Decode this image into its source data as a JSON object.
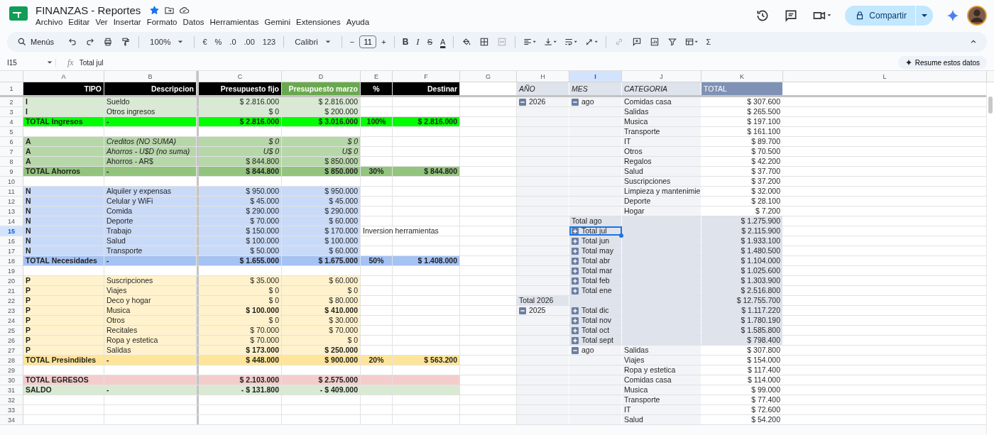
{
  "doc": {
    "title": "FINANZAS - Reportes",
    "starred": true
  },
  "menus": [
    "Archivo",
    "Editar",
    "Ver",
    "Insertar",
    "Formato",
    "Datos",
    "Herramientas",
    "Gemini",
    "Extensiones",
    "Ayuda"
  ],
  "share": {
    "label": "Compartir"
  },
  "toolbar": {
    "search": "Menús",
    "zoom": "100%",
    "number_formats": [
      "€",
      "%",
      ".0",
      ".00",
      "123"
    ],
    "font": "Calibri",
    "size_down": "−",
    "font_size": "11",
    "size_up": "+",
    "text_styles": [
      "B",
      "I",
      "S",
      "A"
    ],
    "sum": "Σ"
  },
  "formula_bar": {
    "cell": "I15",
    "fx": "fx",
    "content": "Total jul"
  },
  "summarize": {
    "label": "Resume estos datos"
  },
  "columns": [
    {
      "label": "A",
      "selected": false
    },
    {
      "label": "B",
      "selected": false
    },
    {
      "label": "C",
      "selected": false
    },
    {
      "label": "D",
      "selected": false
    },
    {
      "label": "E",
      "selected": false
    },
    {
      "label": "F",
      "selected": false
    },
    {
      "label": "G",
      "selected": false
    },
    {
      "label": "H",
      "selected": false
    },
    {
      "label": "I",
      "selected": true
    },
    {
      "label": "J",
      "selected": false
    },
    {
      "label": "K",
      "selected": false
    },
    {
      "label": "L",
      "selected": false
    }
  ],
  "rows": [
    {
      "num": "1",
      "selected": false,
      "kind": "header",
      "tipo": "TIPO",
      "descripcion": "Descripcion",
      "fijo": "Presupuesto fijo",
      "marzo": "Presupuesto marzo",
      "pct": "%",
      "destinar": "Destinar",
      "pivot": {
        "kind": "header",
        "year": "AÑO",
        "month": "MES",
        "category": "CATEGORIA",
        "total": "TOTAL"
      }
    },
    {
      "num": "2",
      "selected": false,
      "kind": "ingreso",
      "tipo": "I",
      "descripcion": "Sueldo",
      "fijo": "$ 2.816.000",
      "marzo": "$ 2.816.000",
      "pivot": {
        "kind": "detail",
        "year": "2026",
        "year_expanded": true,
        "month": "ago",
        "month_expanded": true,
        "category": "Comidas casa",
        "total": "$ 307.600"
      }
    },
    {
      "num": "3",
      "selected": false,
      "kind": "ingreso",
      "tipo": "I",
      "descripcion": "Otros ingresos",
      "fijo": "$ 0",
      "marzo": "$ 200.000",
      "pivot": {
        "kind": "detail",
        "category": "Salidas",
        "total": "$ 265.500"
      }
    },
    {
      "num": "4",
      "selected": false,
      "kind": "ingreso_total",
      "tipo": "TOTAL Ingresos",
      "descripcion": "-",
      "fijo": "$ 2.816.000",
      "marzo": "$ 3.016.000",
      "pct": "100%",
      "destinar": "$ 2.816.000",
      "pivot": {
        "kind": "detail",
        "category": "Musica",
        "total": "$ 197.100"
      }
    },
    {
      "num": "5",
      "selected": false,
      "kind": "blank",
      "pivot": {
        "kind": "detail",
        "category": "Transporte",
        "total": "$ 161.100"
      }
    },
    {
      "num": "6",
      "selected": false,
      "kind": "ahorro_nota",
      "tipo": "A",
      "descripcion": "Creditos (NO SUMA)",
      "fijo": "$ 0",
      "marzo": "$ 0",
      "pivot": {
        "kind": "detail",
        "category": "IT",
        "total": "$ 89.700"
      }
    },
    {
      "num": "7",
      "selected": false,
      "kind": "ahorro_nota",
      "tipo": "A",
      "descripcion": "Ahorros - U$D (no suma)",
      "fijo": "U$ 0",
      "marzo": "U$ 0",
      "pivot": {
        "kind": "detail",
        "category": "Otros",
        "total": "$ 70.500"
      }
    },
    {
      "num": "8",
      "selected": false,
      "kind": "ahorro",
      "tipo": "A",
      "descripcion": "Ahorros - AR$",
      "fijo": "$ 844.800",
      "marzo": "$ 850.000",
      "pivot": {
        "kind": "detail",
        "category": "Regalos",
        "total": "$ 42.200"
      }
    },
    {
      "num": "9",
      "selected": false,
      "kind": "ahorro_total",
      "tipo": "TOTAL Ahorros",
      "descripcion": "-",
      "fijo": "$ 844.800",
      "marzo": "$ 850.000",
      "pct": "30%",
      "destinar": "$ 844.800",
      "pivot": {
        "kind": "detail",
        "category": "Salud",
        "total": "$ 37.700"
      }
    },
    {
      "num": "10",
      "selected": false,
      "kind": "blank",
      "pivot": {
        "kind": "detail",
        "category": "Suscripciones",
        "total": "$ 37.200"
      }
    },
    {
      "num": "11",
      "selected": false,
      "kind": "necesidad",
      "tipo": "N",
      "descripcion": "Alquiler y expensas",
      "fijo": "$ 950.000",
      "marzo": "$ 950.000",
      "pivot": {
        "kind": "detail",
        "category": "Limpieza y mantenimie",
        "total": "$ 32.000"
      }
    },
    {
      "num": "12",
      "selected": false,
      "kind": "necesidad",
      "tipo": "N",
      "descripcion": "Celular y WiFi",
      "fijo": "$ 45.000",
      "marzo": "$ 45.000",
      "pivot": {
        "kind": "detail",
        "category": "Deporte",
        "total": "$ 28.100"
      }
    },
    {
      "num": "13",
      "selected": false,
      "kind": "necesidad",
      "tipo": "N",
      "descripcion": "Comida",
      "fijo": "$ 290.000",
      "marzo": "$ 290.000",
      "pivot": {
        "kind": "detail",
        "category": "Hogar",
        "total": "$ 7.200"
      }
    },
    {
      "num": "14",
      "selected": false,
      "kind": "necesidad",
      "tipo": "N",
      "descripcion": "Deporte",
      "fijo": "$ 70.000",
      "marzo": "$ 60.000",
      "pivot": {
        "kind": "subtotal",
        "month": "Total ago",
        "total": "$ 1.275.900"
      }
    },
    {
      "num": "15",
      "selected": true,
      "kind": "necesidad",
      "tipo": "N",
      "descripcion": "Trabajo",
      "fijo": "$ 150.000",
      "marzo": "$ 170.000",
      "pct": "Inversion herramientas",
      "pivot": {
        "kind": "collapsed",
        "month": "Total jul",
        "month_expanded": false,
        "total": "$ 2.115.900"
      }
    },
    {
      "num": "16",
      "selected": false,
      "kind": "necesidad",
      "tipo": "N",
      "descripcion": "Salud",
      "fijo": "$ 100.000",
      "marzo": "$ 100.000",
      "pivot": {
        "kind": "collapsed",
        "month": "Total jun",
        "month_expanded": false,
        "total": "$ 1.933.100"
      }
    },
    {
      "num": "17",
      "selected": false,
      "kind": "necesidad",
      "tipo": "N",
      "descripcion": "Transporte",
      "fijo": "$ 50.000",
      "marzo": "$ 60.000",
      "pivot": {
        "kind": "collapsed",
        "month": "Total may",
        "month_expanded": false,
        "total": "$ 1.480.500"
      }
    },
    {
      "num": "18",
      "selected": false,
      "kind": "necesidad_total",
      "tipo": "TOTAL Necesidades",
      "descripcion": "-",
      "fijo": "$ 1.655.000",
      "marzo": "$ 1.675.000",
      "pct": "50%",
      "destinar": "$ 1.408.000",
      "pivot": {
        "kind": "collapsed",
        "month": "Total abr",
        "month_expanded": false,
        "total": "$ 1.104.000"
      }
    },
    {
      "num": "19",
      "selected": false,
      "kind": "blank",
      "pivot": {
        "kind": "collapsed",
        "month": "Total mar",
        "month_expanded": false,
        "total": "$ 1.025.600"
      }
    },
    {
      "num": "20",
      "selected": false,
      "kind": "prescindible",
      "tipo": "P",
      "descripcion": "Suscripciones",
      "fijo": "$ 35.000",
      "marzo": "$ 60.000",
      "pivot": {
        "kind": "collapsed",
        "month": "Total feb",
        "month_expanded": false,
        "total": "$ 1.303.900"
      }
    },
    {
      "num": "21",
      "selected": false,
      "kind": "prescindible",
      "tipo": "P",
      "descripcion": "Viajes",
      "fijo": "$ 0",
      "marzo": "$ 0",
      "pivot": {
        "kind": "collapsed",
        "month": "Total ene",
        "month_expanded": false,
        "total": "$ 2.516.800"
      }
    },
    {
      "num": "22",
      "selected": false,
      "kind": "prescindible",
      "tipo": "P",
      "descripcion": "Deco y hogar",
      "fijo": "$ 0",
      "marzo": "$ 80.000",
      "pivot": {
        "kind": "grand",
        "year": "Total 2026",
        "total": "$ 12.755.700"
      }
    },
    {
      "num": "23",
      "selected": false,
      "kind": "prescindible_alto",
      "tipo": "P",
      "descripcion": "Musica",
      "fijo": "$ 100.000",
      "marzo": "$ 410.000",
      "pivot": {
        "kind": "collapsed",
        "year": "2025",
        "year_expanded": true,
        "month": "Total dic",
        "month_expanded": false,
        "total": "$ 1.117.220"
      }
    },
    {
      "num": "24",
      "selected": false,
      "kind": "prescindible",
      "tipo": "P",
      "descripcion": "Otros",
      "fijo": "$ 0",
      "marzo": "$ 30.000",
      "pivot": {
        "kind": "collapsed",
        "month": "Total nov",
        "month_expanded": false,
        "total": "$ 1.780.190"
      }
    },
    {
      "num": "25",
      "selected": false,
      "kind": "prescindible",
      "tipo": "P",
      "descripcion": "Recitales",
      "fijo": "$ 70.000",
      "marzo": "$ 70.000",
      "pivot": {
        "kind": "collapsed",
        "month": "Total oct",
        "month_expanded": false,
        "total": "$ 1.585.800"
      }
    },
    {
      "num": "26",
      "selected": false,
      "kind": "prescindible",
      "tipo": "P",
      "descripcion": "Ropa y estetica",
      "fijo": "$ 70.000",
      "marzo": "$ 0",
      "pivot": {
        "kind": "collapsed",
        "month": "Total sept",
        "month_expanded": false,
        "total": "$ 798.400"
      }
    },
    {
      "num": "27",
      "selected": false,
      "kind": "prescindible_alto",
      "tipo": "P",
      "descripcion": "Salidas",
      "fijo": "$ 173.000",
      "marzo": "$ 250.000",
      "pivot": {
        "kind": "detail",
        "month": "ago",
        "month_expanded": true,
        "category": "Salidas",
        "total": "$ 307.800"
      }
    },
    {
      "num": "28",
      "selected": false,
      "kind": "prescindible_total",
      "tipo": "TOTAL Presindibles",
      "descripcion": "-",
      "fijo": "$ 448.000",
      "marzo": "$ 900.000",
      "pct": "20%",
      "destinar": "$ 563.200",
      "pivot": {
        "kind": "detail",
        "category": "Viajes",
        "total": "$ 154.000"
      }
    },
    {
      "num": "29",
      "selected": false,
      "kind": "blank",
      "pivot": {
        "kind": "detail",
        "category": "Ropa y estetica",
        "total": "$ 117.400"
      }
    },
    {
      "num": "30",
      "selected": false,
      "kind": "egresos",
      "tipo": "TOTAL EGRESOS",
      "fijo": "$ 2.103.000",
      "marzo": "$ 2.575.000",
      "pivot": {
        "kind": "detail",
        "category": "Comidas casa",
        "total": "$ 114.000"
      }
    },
    {
      "num": "31",
      "selected": false,
      "kind": "saldo",
      "tipo": "SALDO",
      "descripcion": "-",
      "fijo": "- $ 131.800",
      "marzo": "- $ 409.000",
      "pivot": {
        "kind": "detail",
        "category": "Musica",
        "total": "$ 99.000"
      }
    },
    {
      "num": "32",
      "selected": false,
      "kind": "blank",
      "pivot": {
        "kind": "detail",
        "category": "Transporte",
        "total": "$ 77.400"
      }
    },
    {
      "num": "33",
      "selected": false,
      "kind": "blank",
      "pivot": {
        "kind": "detail",
        "category": "IT",
        "total": "$ 72.600"
      }
    },
    {
      "num": "34",
      "selected": false,
      "kind": "blank",
      "pivot": {
        "kind": "detail",
        "category": "Salud",
        "total": "$ 54.200"
      }
    }
  ]
}
